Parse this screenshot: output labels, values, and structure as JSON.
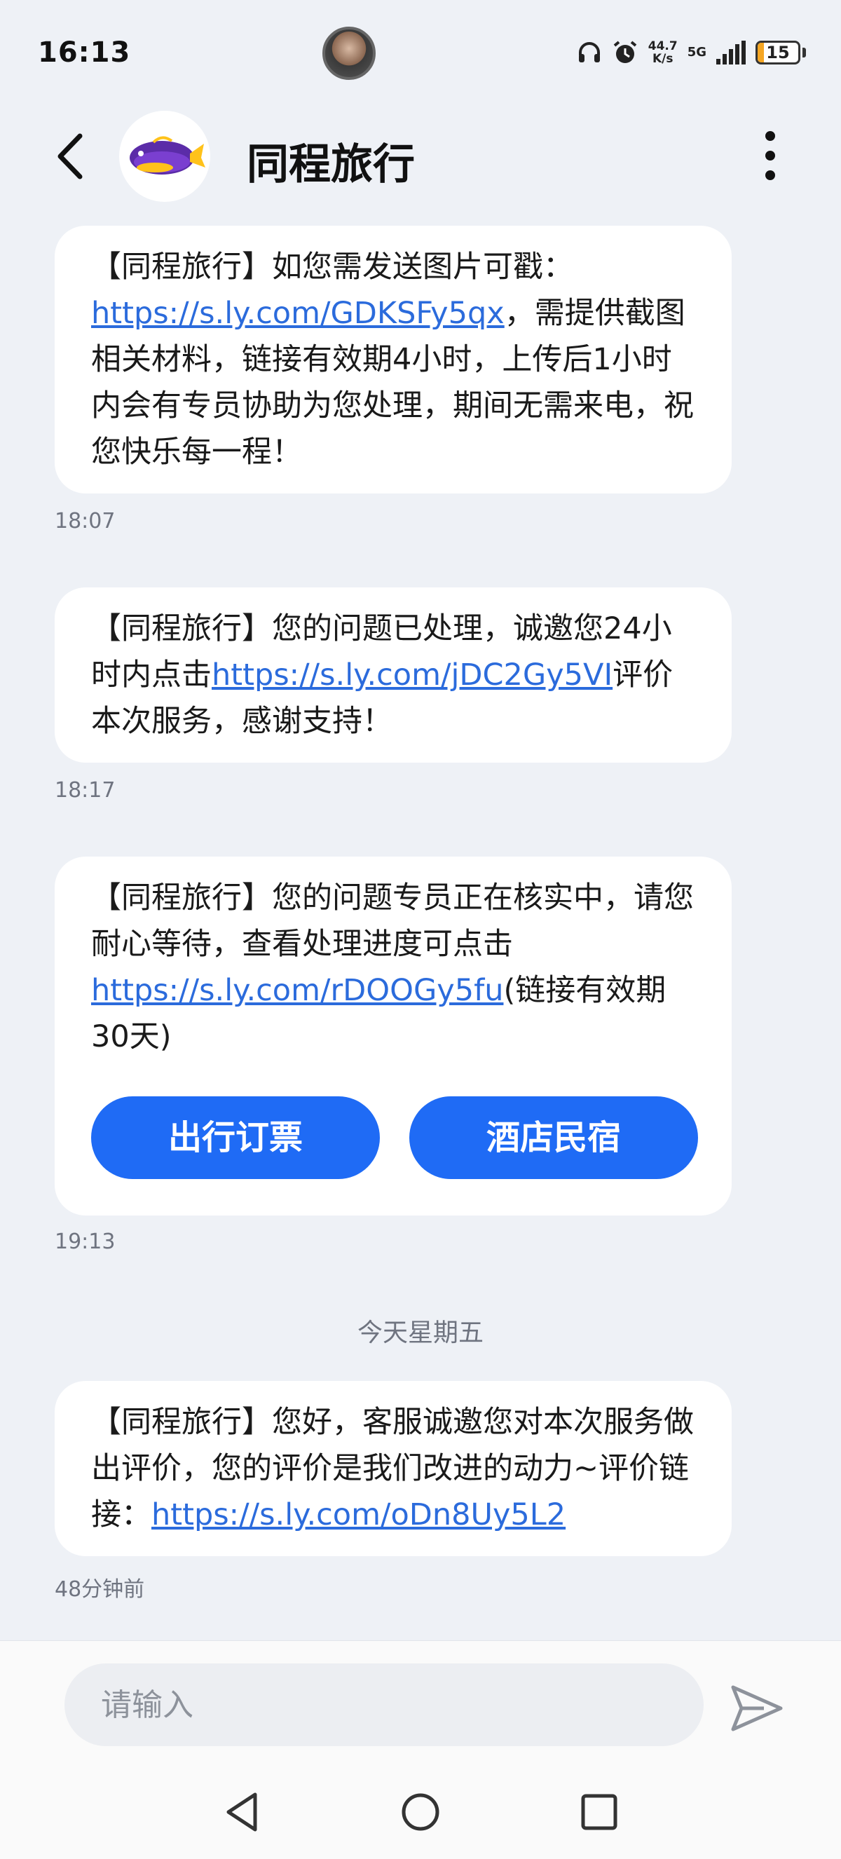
{
  "status_bar": {
    "time": "16:13",
    "speed_value": "44.7",
    "speed_unit": "K/s",
    "network": "5G",
    "battery": "15",
    "battery_level": 0.15,
    "icons": [
      "avatar",
      "headphones-icon",
      "alarm-icon",
      "signal-icon",
      "battery-icon"
    ]
  },
  "header": {
    "title": "同程旅行",
    "logo_icon": "whale-logo"
  },
  "messages": [
    {
      "text_before": "【同程旅行】如您需发送图片可戳：",
      "link": "https://s.ly.com/GDKSFy5qx",
      "text_after": "，需提供截图相关材料，链接有效期4小时，上传后1小时内会有专员协助为您处理，期间无需来电，祝您快乐每一程！",
      "time": "18:07"
    },
    {
      "text_before": "【同程旅行】您的问题已处理，诚邀您24小时内点击",
      "link": "https://s.ly.com/jDC2Gy5VI",
      "text_after": "评价本次服务，感谢支持！",
      "time": "18:17"
    },
    {
      "text_before": "【同程旅行】您的问题专员正在核实中，请您耐心等待，查看处理进度可点击",
      "link": "https://s.ly.com/rDOOGy5fu",
      "text_after": "(链接有效期30天)",
      "actions": [
        "出行订票",
        "酒店民宿"
      ],
      "time": "19:13"
    },
    {
      "text_before": "【同程旅行】您好，客服诚邀您对本次服务做出评价，您的评价是我们改进的动力~评价链接：",
      "link": "https://s.ly.com/oDn8Uy5L2",
      "text_after": "",
      "time": "48分钟前"
    }
  ],
  "day_separator": "今天星期五",
  "composer": {
    "placeholder": "请输入"
  },
  "colors": {
    "accent": "#1f6bf5",
    "link": "#2b6bdc",
    "background": "#eef1f6",
    "bubble": "#ffffff"
  }
}
